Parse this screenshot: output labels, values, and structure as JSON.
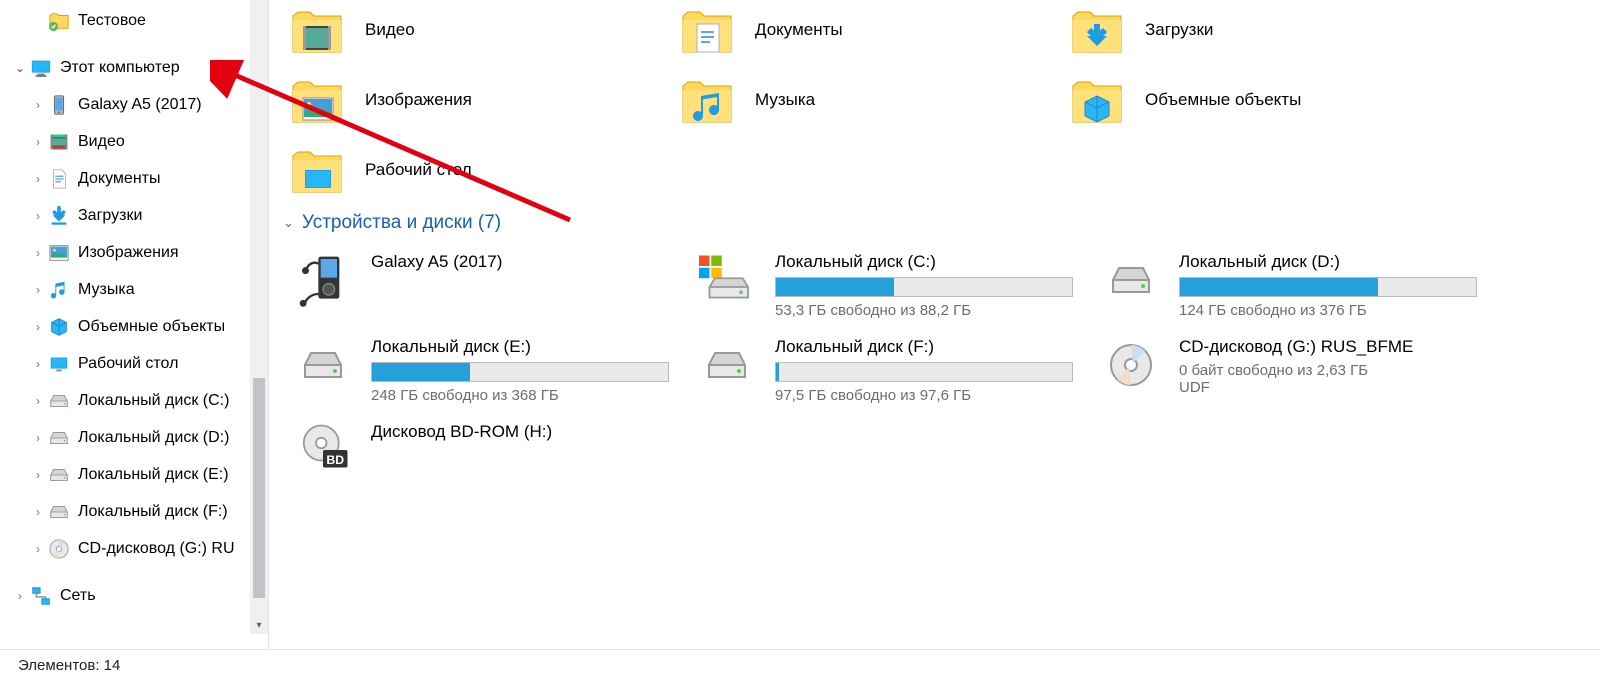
{
  "sidebar": {
    "items": [
      {
        "label": "Тестовое",
        "icon": "folder-check",
        "chev": "",
        "indent": 1
      },
      {
        "label": "Этот компьютер",
        "icon": "computer",
        "chev": "v",
        "indent": 0,
        "spacer_before": true
      },
      {
        "label": "Galaxy A5 (2017)",
        "icon": "phone",
        "chev": ">",
        "indent": 1
      },
      {
        "label": "Видео",
        "icon": "video",
        "chev": ">",
        "indent": 1
      },
      {
        "label": "Документы",
        "icon": "document",
        "chev": ">",
        "indent": 1
      },
      {
        "label": "Загрузки",
        "icon": "download",
        "chev": ">",
        "indent": 1
      },
      {
        "label": "Изображения",
        "icon": "picture",
        "chev": ">",
        "indent": 1
      },
      {
        "label": "Музыка",
        "icon": "music",
        "chev": ">",
        "indent": 1
      },
      {
        "label": "Объемные объекты",
        "icon": "cube",
        "chev": ">",
        "indent": 1
      },
      {
        "label": "Рабочий стол",
        "icon": "desktop",
        "chev": ">",
        "indent": 1
      },
      {
        "label": "Локальный диск (C:)",
        "icon": "drive",
        "chev": ">",
        "indent": 1
      },
      {
        "label": "Локальный диск (D:)",
        "icon": "drive",
        "chev": ">",
        "indent": 1
      },
      {
        "label": "Локальный диск (E:)",
        "icon": "drive",
        "chev": ">",
        "indent": 1
      },
      {
        "label": "Локальный диск (F:)",
        "icon": "drive",
        "chev": ">",
        "indent": 1
      },
      {
        "label": "CD-дисковод (G:) RU",
        "icon": "cd",
        "chev": ">",
        "indent": 1
      },
      {
        "label": "Сеть",
        "icon": "network",
        "chev": ">",
        "indent": 0,
        "spacer_before": true
      }
    ]
  },
  "folders": [
    {
      "label": "Видео",
      "icon": "video"
    },
    {
      "label": "Документы",
      "icon": "document"
    },
    {
      "label": "Загрузки",
      "icon": "download"
    },
    {
      "label": "",
      "icon": "blank"
    },
    {
      "label": "Изображения",
      "icon": "picture"
    },
    {
      "label": "Музыка",
      "icon": "music"
    },
    {
      "label": "Объемные объекты",
      "icon": "cube"
    },
    {
      "label": "",
      "icon": "blank"
    },
    {
      "label": "Рабочий стол",
      "icon": "desktop"
    }
  ],
  "section": {
    "title": "Устройства и диски (7)",
    "chev": "⌄"
  },
  "drives": [
    {
      "name": "Galaxy A5 (2017)",
      "icon": "mp3",
      "bar": null,
      "sub": ""
    },
    {
      "name": "Локальный диск (C:)",
      "icon": "drive-win",
      "bar": 40,
      "sub": "53,3 ГБ свободно из 88,2 ГБ"
    },
    {
      "name": "Локальный диск (D:)",
      "icon": "drive",
      "bar": 67,
      "sub": "124 ГБ свободно из 376 ГБ"
    },
    {
      "name": "Локальный диск (E:)",
      "icon": "drive",
      "bar": 33,
      "sub": "248 ГБ свободно из 368 ГБ"
    },
    {
      "name": "Локальный диск (F:)",
      "icon": "drive",
      "bar": 1,
      "sub": "97,5 ГБ свободно из 97,6 ГБ"
    },
    {
      "name": "CD-дисковод (G:) RUS_BFME",
      "icon": "cd",
      "bar": null,
      "sub": "0 байт свободно из 2,63 ГБ",
      "sub2": "UDF"
    },
    {
      "name": "Дисковод BD-ROM (H:)",
      "icon": "bd",
      "bar": null,
      "sub": ""
    }
  ],
  "status": "Элементов: 14"
}
